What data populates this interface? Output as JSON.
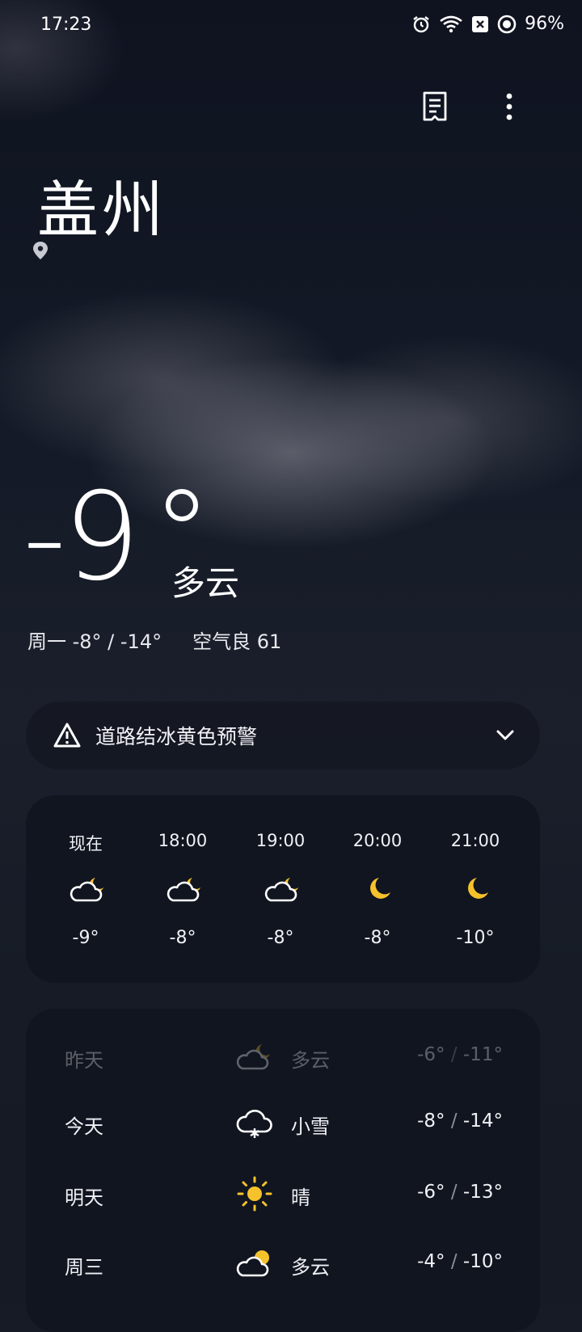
{
  "status_bar": {
    "time": "17:23",
    "battery": "96%",
    "icons": [
      "alarm-icon",
      "wifi-icon",
      "sim-off-icon",
      "battery-icon"
    ]
  },
  "toolbar": {
    "icons": [
      "report-icon",
      "more-vert-icon"
    ]
  },
  "location": {
    "city": "盖州"
  },
  "current": {
    "temperature": "-9",
    "condition": "多云",
    "summary_day": "周一 -8° / -14°",
    "air_quality": "空气良 61"
  },
  "alert": {
    "text": "道路结冰黄色预警"
  },
  "hourly": [
    {
      "time": "现在",
      "icon": "cloudy-night-icon",
      "temp": "-9°"
    },
    {
      "time": "18:00",
      "icon": "cloudy-night-icon",
      "temp": "-8°"
    },
    {
      "time": "19:00",
      "icon": "cloudy-night-icon",
      "temp": "-8°"
    },
    {
      "time": "20:00",
      "icon": "moon-icon",
      "temp": "-8°"
    },
    {
      "time": "21:00",
      "icon": "moon-icon",
      "temp": "-10°"
    }
  ],
  "daily": [
    {
      "day": "昨天",
      "icon": "cloudy-night-icon",
      "condition": "多云",
      "high": "-6°",
      "low": "-11°"
    },
    {
      "day": "今天",
      "icon": "snow-icon",
      "condition": "小雪",
      "high": "-8°",
      "low": "-14°"
    },
    {
      "day": "明天",
      "icon": "sun-icon",
      "condition": "晴",
      "high": "-6°",
      "low": "-13°"
    },
    {
      "day": "周三",
      "icon": "partly-cloudy-icon",
      "condition": "多云",
      "high": "-4°",
      "low": "-10°"
    }
  ],
  "colors": {
    "accent_yellow": "#f5c22b",
    "background": "#161b26",
    "card": "#111520"
  }
}
